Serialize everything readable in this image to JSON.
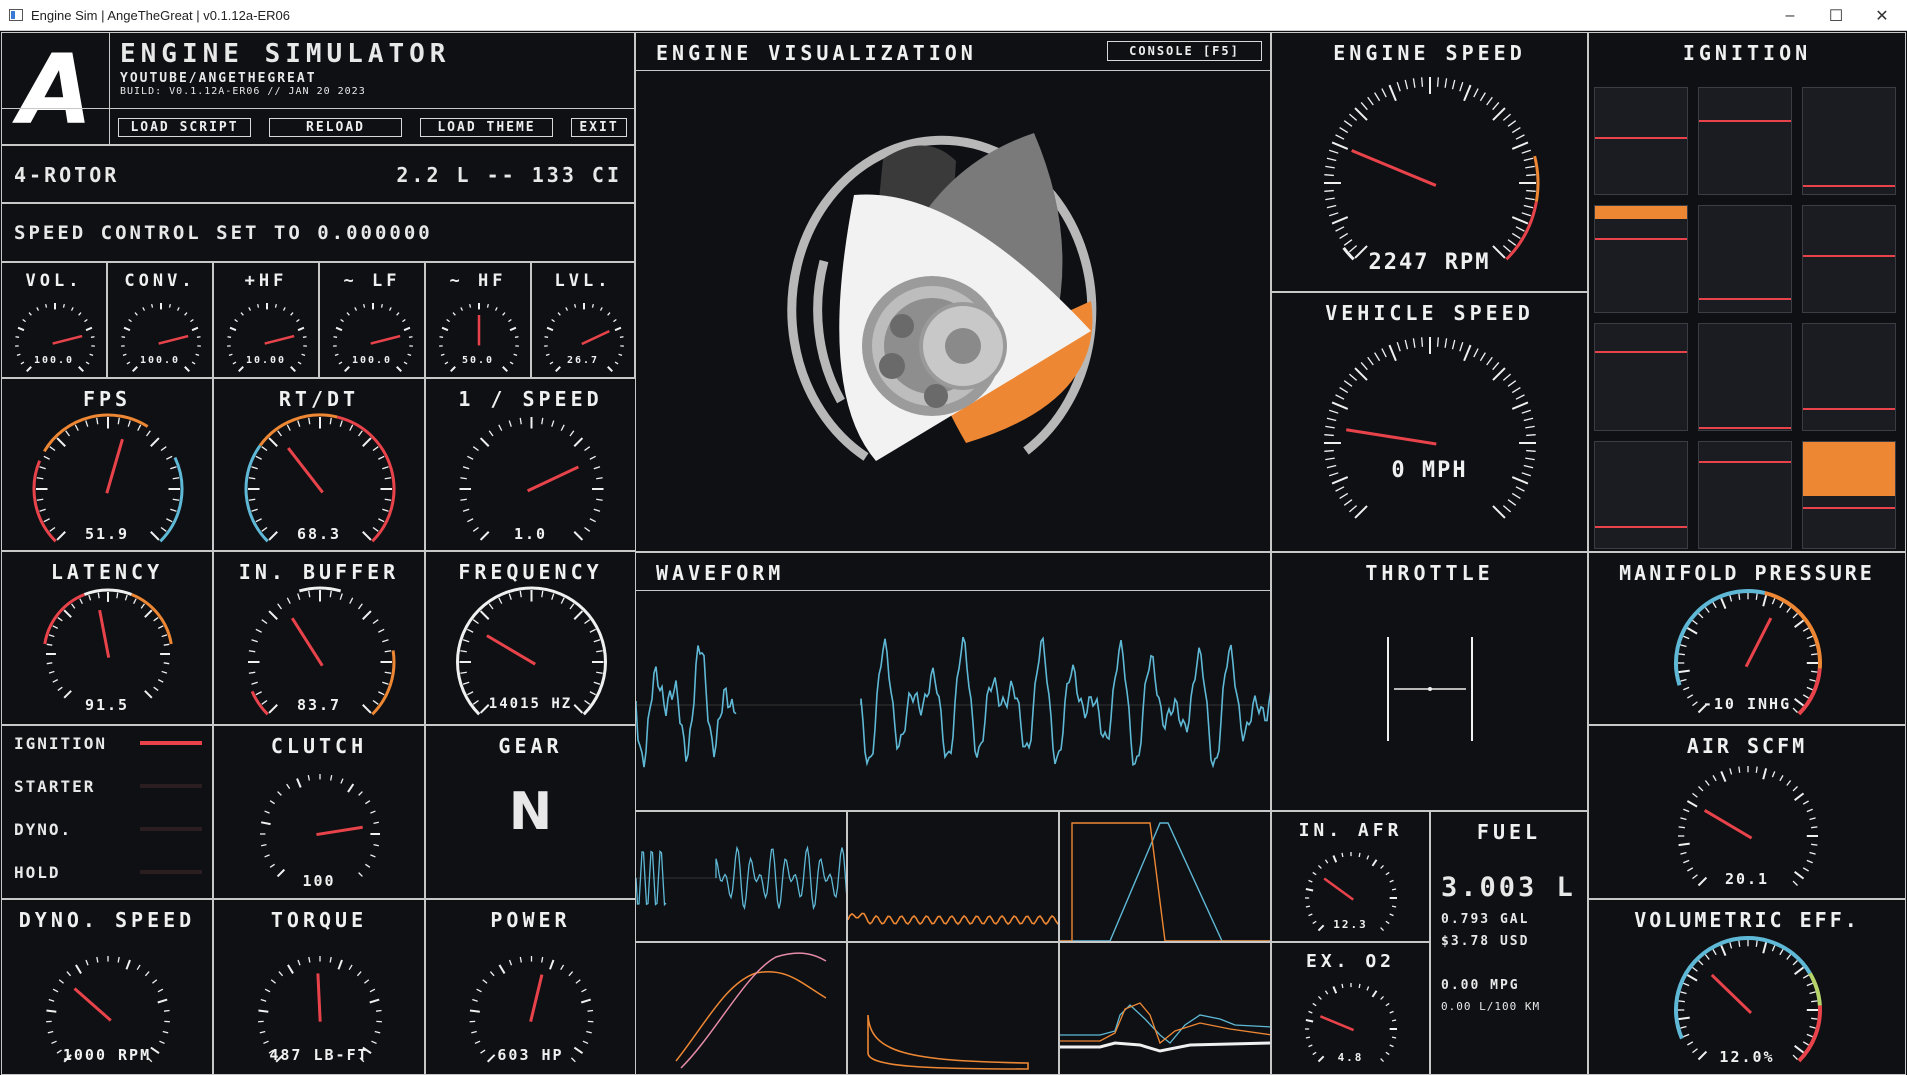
{
  "window": {
    "title": "Engine Sim | AngeTheGreat | v0.1.12a-ER06",
    "controls": [
      "–",
      "☐",
      "✕"
    ]
  },
  "header": {
    "logo_letter": "A",
    "app_name": "ENGINE SIMULATOR",
    "channel": "YOUTUBE/ANGETHEGREAT",
    "build": "BUILD: V0.1.12A-ER06 // JAN 20 2023",
    "buttons": {
      "load_script": "LOAD SCRIPT",
      "reload": "RELOAD",
      "load_theme": "LOAD THEME",
      "exit": "EXIT"
    }
  },
  "engine_info": {
    "name": "4-ROTOR",
    "displacement": "2.2 L -- 133 CI"
  },
  "speed_control": "SPEED CONTROL SET TO 0.000000",
  "mixer": [
    {
      "label": "VOL.",
      "value": "100.0",
      "level": 0.78
    },
    {
      "label": "CONV.",
      "value": "100.0",
      "level": 0.78
    },
    {
      "label": "+HF",
      "value": "10.00",
      "level": 0.78
    },
    {
      "label": "~ LF",
      "value": "100.0",
      "level": 0.78
    },
    {
      "label": "~ HF",
      "value": "50.0",
      "level": 0.5
    },
    {
      "label": "LVL.",
      "value": "26.7",
      "level": 0.74
    }
  ],
  "perf_gauges": {
    "fps": {
      "label": "FPS",
      "value": "51.9",
      "level": 0.56
    },
    "rtdt": {
      "label": "RT/DT",
      "value": "68.3",
      "level": 0.36
    },
    "inv_speed": {
      "label": "1 / SPEED",
      "value": "1.0",
      "level": 0.74
    },
    "latency": {
      "label": "LATENCY",
      "value": "91.5",
      "level": 0.46
    },
    "in_buffer": {
      "label": "IN. BUFFER",
      "value": "83.7",
      "level": 0.38
    },
    "frequency": {
      "label": "FREQUENCY",
      "value": "14015 HZ",
      "level": 0.28
    }
  },
  "toggles": [
    {
      "label": "IGNITION",
      "on": true
    },
    {
      "label": "STARTER",
      "on": false
    },
    {
      "label": "DYNO.",
      "on": false
    },
    {
      "label": "HOLD",
      "on": false
    }
  ],
  "clutch": {
    "label": "CLUTCH",
    "value": "100",
    "level": 0.8
  },
  "gear": {
    "label": "GEAR",
    "value": "N"
  },
  "dyno": {
    "speed": {
      "label": "DYNO. SPEED",
      "value": "1000 RPM",
      "level": 0.32
    },
    "torque": {
      "label": "TORQUE",
      "value": "487 LB-FT",
      "level": 0.49
    },
    "power": {
      "label": "POWER",
      "value": "603 HP",
      "level": 0.55
    }
  },
  "visualization": {
    "title": "ENGINE VISUALIZATION",
    "console_button": "CONSOLE [F5]"
  },
  "engine_speed": {
    "label": "ENGINE SPEED",
    "value": "2247 RPM",
    "level": 0.25
  },
  "vehicle_speed": {
    "label": "VEHICLE SPEED",
    "value": "0 MPH",
    "level": 0.2
  },
  "ignition_panel": {
    "title": "IGNITION",
    "cells": [
      {
        "marks": [
          0.45
        ]
      },
      {
        "marks": [
          0.3
        ]
      },
      {
        "marks": [
          0.9
        ]
      },
      {
        "marks": [
          0.05,
          0.3
        ],
        "fill": 0.12
      },
      {
        "marks": [
          0.85
        ]
      },
      {
        "marks": [
          0.45
        ]
      },
      {
        "marks": [
          0.25
        ]
      },
      {
        "marks": [
          0.95
        ]
      },
      {
        "marks": [
          0.78
        ]
      },
      {
        "marks": [
          0.78
        ]
      },
      {
        "marks": [
          0.18
        ]
      },
      {
        "marks": [
          0.6
        ],
        "fill_block": true
      }
    ]
  },
  "waveform": {
    "title": "WAVEFORM"
  },
  "throttle": {
    "label": "THROTTLE"
  },
  "manifold": {
    "label": "MANIFOLD PRESSURE",
    "value": "-10 INHG",
    "level": 0.6
  },
  "air_scfm": {
    "label": "AIR SCFM",
    "value": "20.1",
    "level": 0.28
  },
  "in_afr": {
    "label": "IN. AFR",
    "value": "12.3",
    "level": 0.3
  },
  "ex_o2": {
    "label": "EX. O2",
    "value": "4.8",
    "level": 0.25
  },
  "fuel": {
    "label": "FUEL",
    "liters": "3.003 L",
    "gallons": "0.793 GAL",
    "cost": "$3.78 USD",
    "mpg": "0.00 MPG",
    "l100": "0.00 L/100 KM"
  },
  "vol_eff": {
    "label": "VOLUMETRIC EFF.",
    "value": "12.0%",
    "level": 0.33
  },
  "colors": {
    "red": "#e8434a",
    "orange": "#ee8733",
    "blue": "#5fb9d6",
    "white": "#f0f0f0",
    "grid": "#c8c8c8",
    "gray": "#9a9a9a"
  }
}
